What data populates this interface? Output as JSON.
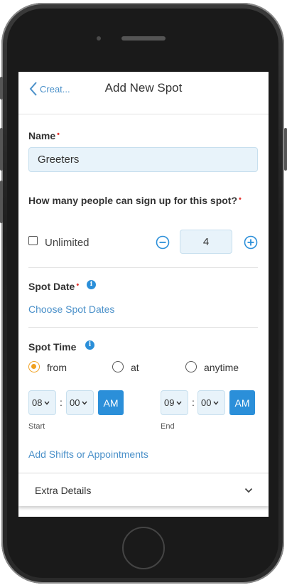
{
  "nav": {
    "back_label": "Creat...",
    "title": "Add New Spot"
  },
  "form": {
    "name_label": "Name",
    "required_mark": "•",
    "name_value": "Greeters",
    "capacity_question": "How many people can sign up for this spot?",
    "unlimited_label": "Unlimited",
    "unlimited_checked": false,
    "quantity": "4",
    "spot_date_label": "Spot Date",
    "choose_dates_link": "Choose Spot Dates",
    "spot_time_label": "Spot Time",
    "info_glyph": "i",
    "time_modes": [
      {
        "label": "from",
        "selected": true
      },
      {
        "label": "at",
        "selected": false
      },
      {
        "label": "anytime",
        "selected": false
      }
    ],
    "start": {
      "hour": "08",
      "minute": "00",
      "ampm": "AM",
      "label": "Start"
    },
    "end": {
      "hour": "09",
      "minute": "00",
      "ampm": "AM",
      "label": "End"
    },
    "colon": ":",
    "add_shifts_link": "Add Shifts or Appointments",
    "extra_details": "Extra Details"
  },
  "colors": {
    "accent": "#2b8fd9",
    "link": "#4a90c9",
    "radio_selected": "#f0a020",
    "required": "#e53935",
    "input_bg": "#e8f3fa"
  },
  "icons": {
    "back": "chevron-left-icon",
    "minus": "minus-circle-icon",
    "plus": "plus-circle-icon",
    "info": "info-icon",
    "dropdown": "chevron-down-icon"
  }
}
